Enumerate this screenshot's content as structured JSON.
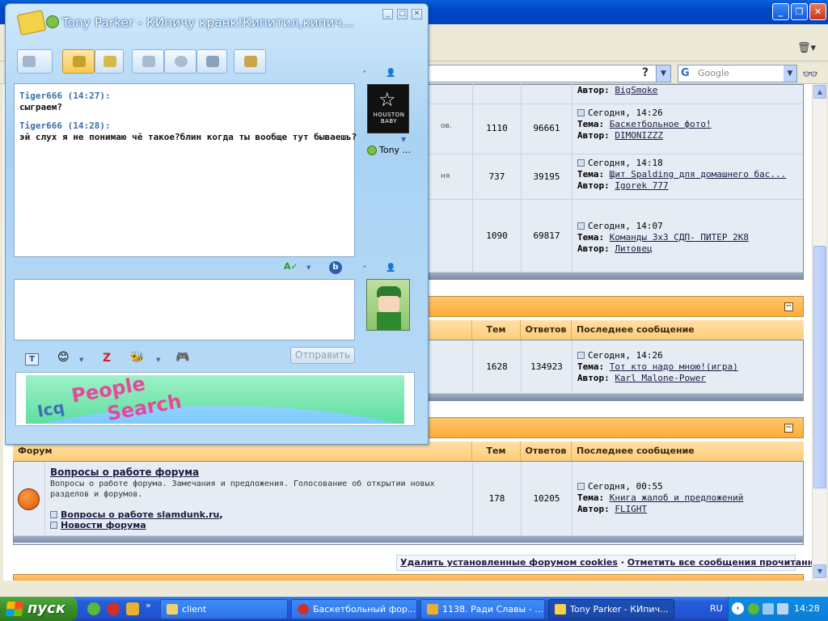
{
  "icq": {
    "title": "Tony Parker - КИпичу кранк!Кипитил,кипич...",
    "messages": [
      {
        "header": "Tiger666 (14:27):",
        "text": "сыграем?"
      },
      {
        "header": "Tiger666 (14:28):",
        "text": "эй слух я не понимаю чё такое?блин когда ты вообще тут бываешь?"
      }
    ],
    "contact_name": "Tony ...",
    "avatar_caption": "HOUSTON BABY",
    "send_label": "Отправить",
    "banner": {
      "icq": "Icq",
      "people": "People",
      "search": "Search"
    }
  },
  "browser": {
    "search_placeholder": "Google",
    "help_glyph": "?"
  },
  "forum": {
    "headers": {
      "forum": "Форум",
      "topics": "Тем",
      "replies": "Ответов",
      "last_post": "Последнее сообщение"
    },
    "labels": {
      "tema": "Тема:",
      "author": "Автор:"
    },
    "rows_top": [
      {
        "author_only": "BigSmoke"
      },
      {
        "desc_frag": "ов.",
        "topics": "1110",
        "replies": "96661",
        "date": "Сегодня, 14:26",
        "topic": "Баскетбольное фото!",
        "author": "DIMONIZZZ"
      },
      {
        "desc_frag": "ня",
        "topics": "737",
        "replies": "39195",
        "date": "Сегодня, 14:18",
        "topic": "Щит Spalding для домашнего бас...",
        "author": "Igorek 777"
      },
      {
        "topics": "1090",
        "replies": "69817",
        "date": "Сегодня, 14:07",
        "topic": "Команды 3х3 СДП- ПИТЕР 2К8",
        "author": "Литовец"
      }
    ],
    "row_mid": {
      "topics": "1628",
      "replies": "134923",
      "date": "Сегодня, 14:26",
      "topic": "Тот кто надо мною!(игра)",
      "author": "Karl Malone-Power"
    },
    "row_bottom": {
      "title": "Вопросы о работе форума",
      "desc": "Вопросы о работе форума. Замечания и предложения. Голосование об открытии новых разделов и форумов.",
      "sub1": "Вопросы о работе slamdunk.ru",
      "sub2": "Новости форума",
      "topics": "178",
      "replies": "10205",
      "date": "Сегодня, 00:55",
      "topic": "Книга жалоб и предложений",
      "author": "FLIGHT"
    },
    "footer_links": {
      "delete_cookies": "Удалить установленные форумом cookies",
      "separator": "·",
      "mark_read": "Отметить все сообщения прочитанными"
    }
  },
  "taskbar": {
    "start": "пуск",
    "tasks": [
      {
        "label": "client"
      },
      {
        "label": "Баскетбольный фор..."
      },
      {
        "label": "1138. Ради Славы - ..."
      },
      {
        "label": "Tony Parker - КИпич..."
      }
    ],
    "lang": "RU",
    "clock": "14:28"
  }
}
